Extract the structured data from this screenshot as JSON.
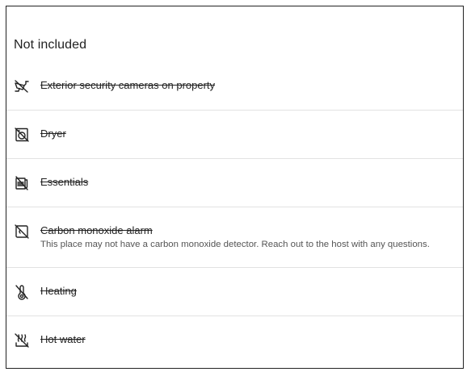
{
  "section": {
    "title": "Not included"
  },
  "items": [
    {
      "label": "Exterior security cameras on property",
      "icon": "no-security-camera-icon"
    },
    {
      "label": "Dryer",
      "icon": "no-dryer-icon"
    },
    {
      "label": "Essentials",
      "icon": "no-essentials-icon"
    },
    {
      "label": "Carbon monoxide alarm",
      "icon": "no-carbon-monoxide-alarm-icon",
      "description": "This place may not have a carbon monoxide detector. Reach out to the host with any questions."
    },
    {
      "label": "Heating",
      "icon": "no-heating-icon"
    },
    {
      "label": "Hot water",
      "icon": "no-hot-water-icon"
    }
  ]
}
